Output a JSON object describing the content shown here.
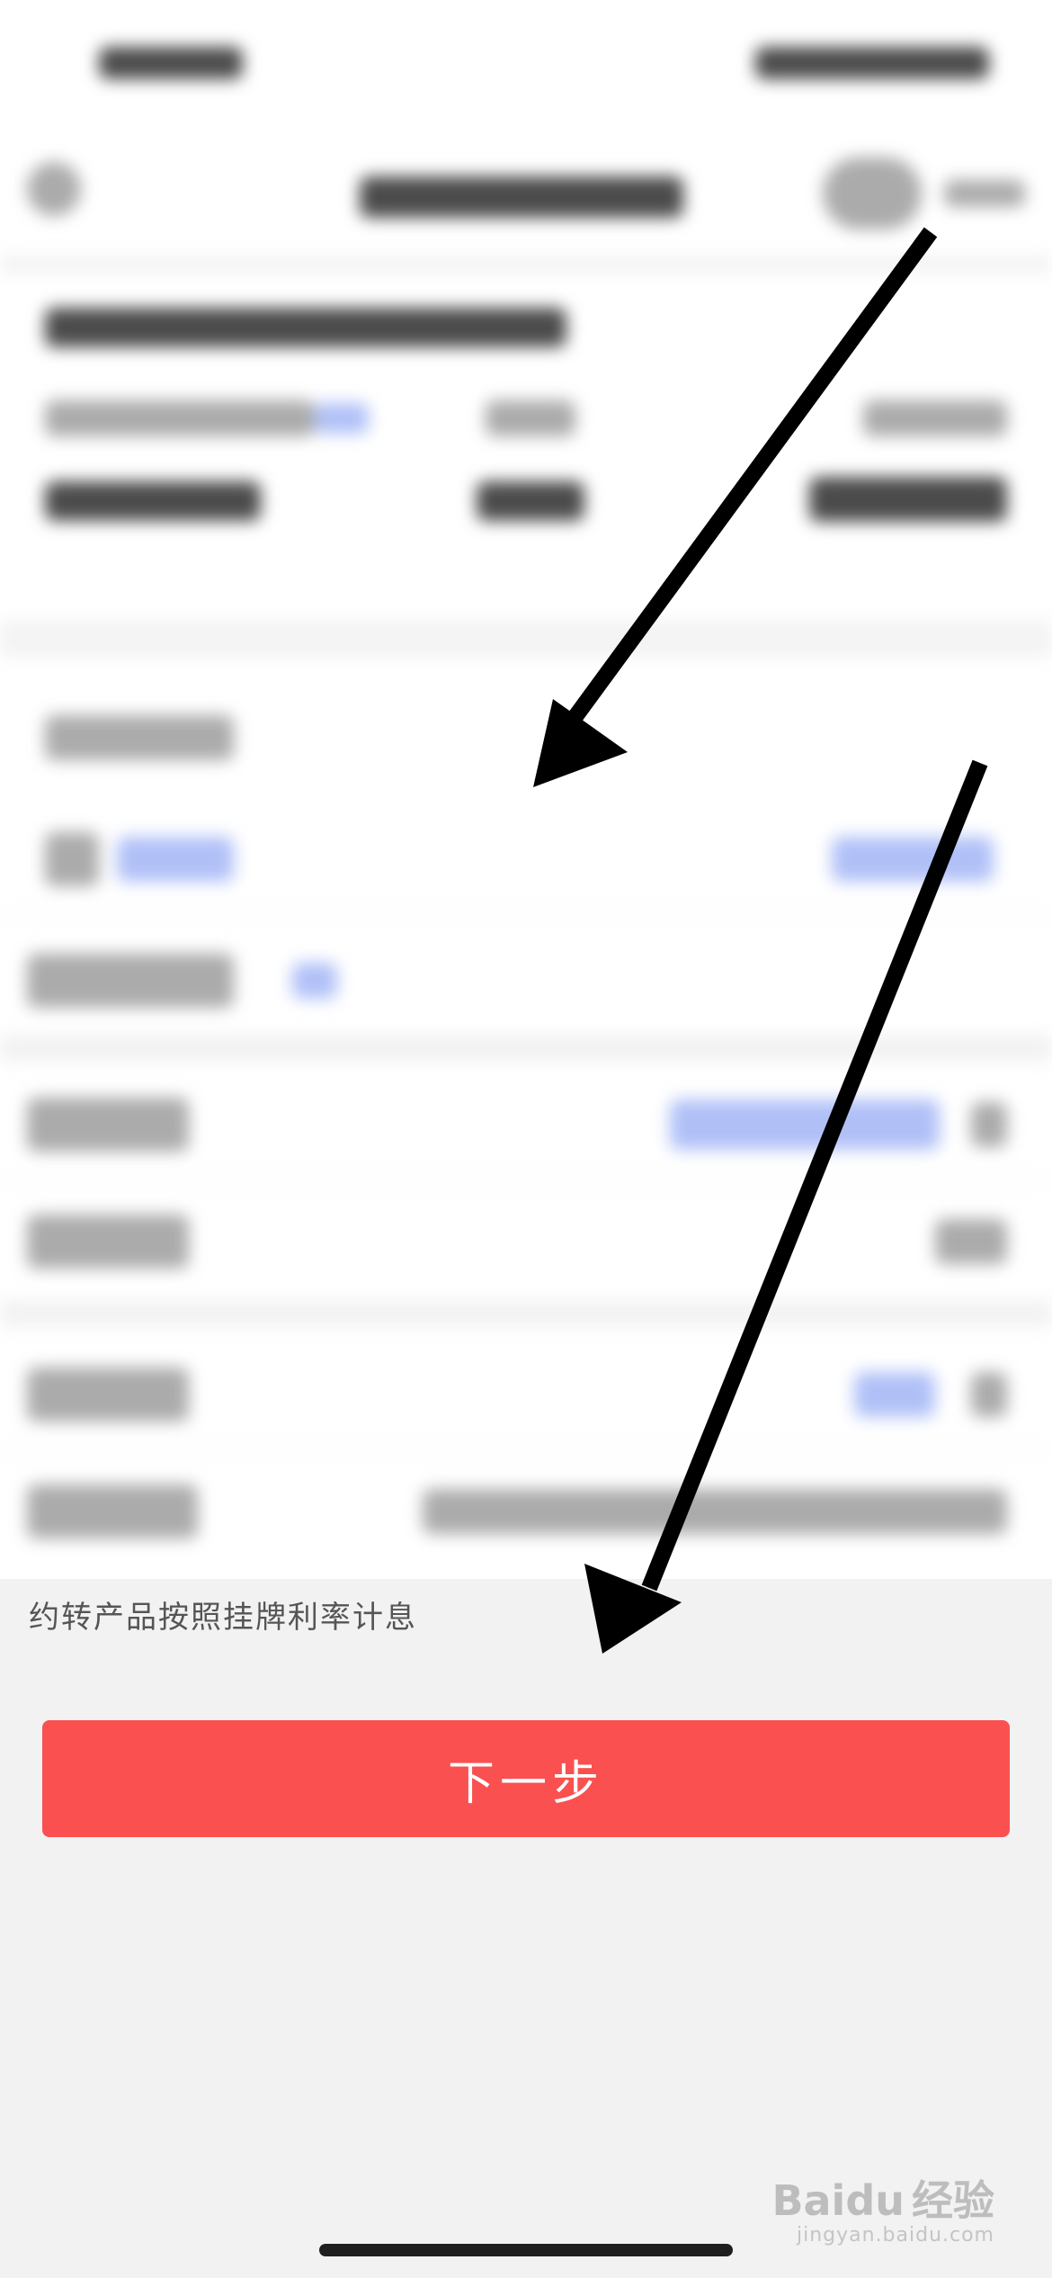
{
  "footer": {
    "note": "约转产品按照挂牌利率计息",
    "next_button_label": "下一步"
  },
  "watermark": {
    "brand": "Baidu",
    "brand_cn": "经验",
    "url": "jingyan.baidu.com"
  }
}
